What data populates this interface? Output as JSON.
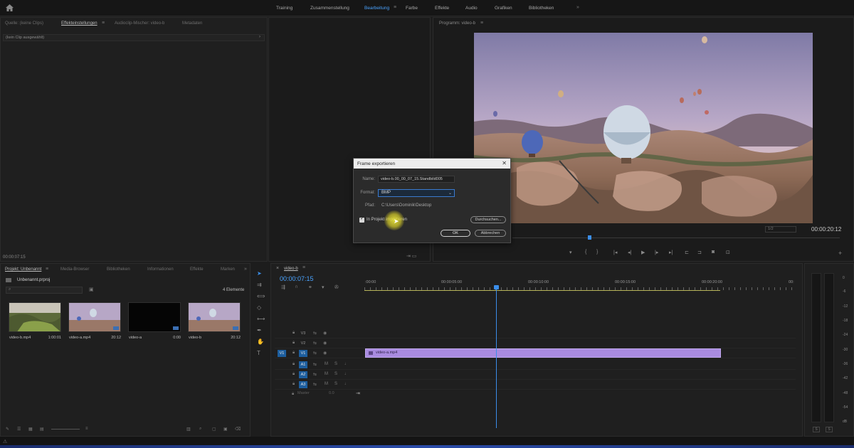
{
  "workspaces": {
    "tabs": [
      "Training",
      "Zusammenstellung",
      "Bearbeitung",
      "Farbe",
      "Effekte",
      "Audio",
      "Grafiken",
      "Bibliotheken"
    ],
    "active": "Bearbeitung",
    "more": "»"
  },
  "source_panel": {
    "tabs": [
      "Quelle: (keine Clips)",
      "Effekteinstellungen",
      "Audioclip-Mischer: video-b",
      "Metadaten"
    ],
    "active_tab": "Effekteinstellungen",
    "no_clip": "(kein Clip ausgewählt)",
    "timecode": "00:00:07:15"
  },
  "program_monitor": {
    "title": "Programm: video-b",
    "timecode": "00:00:20:12",
    "fit": "1/2"
  },
  "dialog": {
    "title": "Frame exportieren",
    "close": "✕",
    "name_label": "Name:",
    "name_value": "video-b.00_00_07_15.Standbild005",
    "format_label": "Format:",
    "format_value": "BMP",
    "path_label": "Pfad:",
    "path_value": "C:\\Users\\Dominik\\Desktop",
    "checkbox_label": "In Projekt importieren",
    "checkbox_checked": true,
    "browse": "Durchsuchen...",
    "ok": "OK",
    "cancel": "Abbrechen"
  },
  "project_panel": {
    "tabs": [
      "Projekt: Unbenannt",
      "Media-Browser",
      "Bibliotheken",
      "Informationen",
      "Effekte",
      "Marken"
    ],
    "active_tab": "Projekt: Unbenannt",
    "file": "Unbenannt.prproj",
    "count": "4 Elemente",
    "items": [
      {
        "name": "video-b.mp4",
        "duration": "1:00:01"
      },
      {
        "name": "video-a.mp4",
        "duration": "20:12"
      },
      {
        "name": "video-a",
        "duration": "0:00"
      },
      {
        "name": "video-b",
        "duration": "20:12"
      }
    ]
  },
  "timeline": {
    "sequence": "video-b",
    "timecode": "00:00:07:15",
    "ruler": [
      ":00:00",
      "00:00:05:00",
      "00:00:10:00",
      "00:00:15:00",
      "00:00:20:00",
      "00:"
    ],
    "tracks": [
      {
        "src": "",
        "label": "V3"
      },
      {
        "src": "",
        "label": "V2"
      },
      {
        "src": "V1",
        "label": "V1"
      },
      {
        "src": "",
        "label": "A1"
      },
      {
        "src": "",
        "label": "A2"
      },
      {
        "src": "",
        "label": "A3"
      }
    ],
    "clip": "video-a.mp4",
    "master_label": "Master",
    "master_value": "0.0"
  },
  "audio_meter": {
    "scale": [
      "0",
      "-6",
      "-12",
      "-18",
      "-24",
      "-30",
      "-36",
      "-42",
      "-48",
      "-54",
      "dB"
    ],
    "buttons": [
      "S",
      "S"
    ]
  },
  "icons": [
    "home-icon",
    "panel-menu-icon",
    "search-icon",
    "new-bin-icon",
    "snap-icon",
    "wrench-icon",
    "lock-icon",
    "eye-icon",
    "mic-icon",
    "play-icon",
    "export-frame-icon",
    "plus-icon"
  ],
  "colors": {
    "accent": "#3b8eea",
    "clip": "#a98be0",
    "playhead": "#3b8eea",
    "highlight": "#e6e13c"
  }
}
